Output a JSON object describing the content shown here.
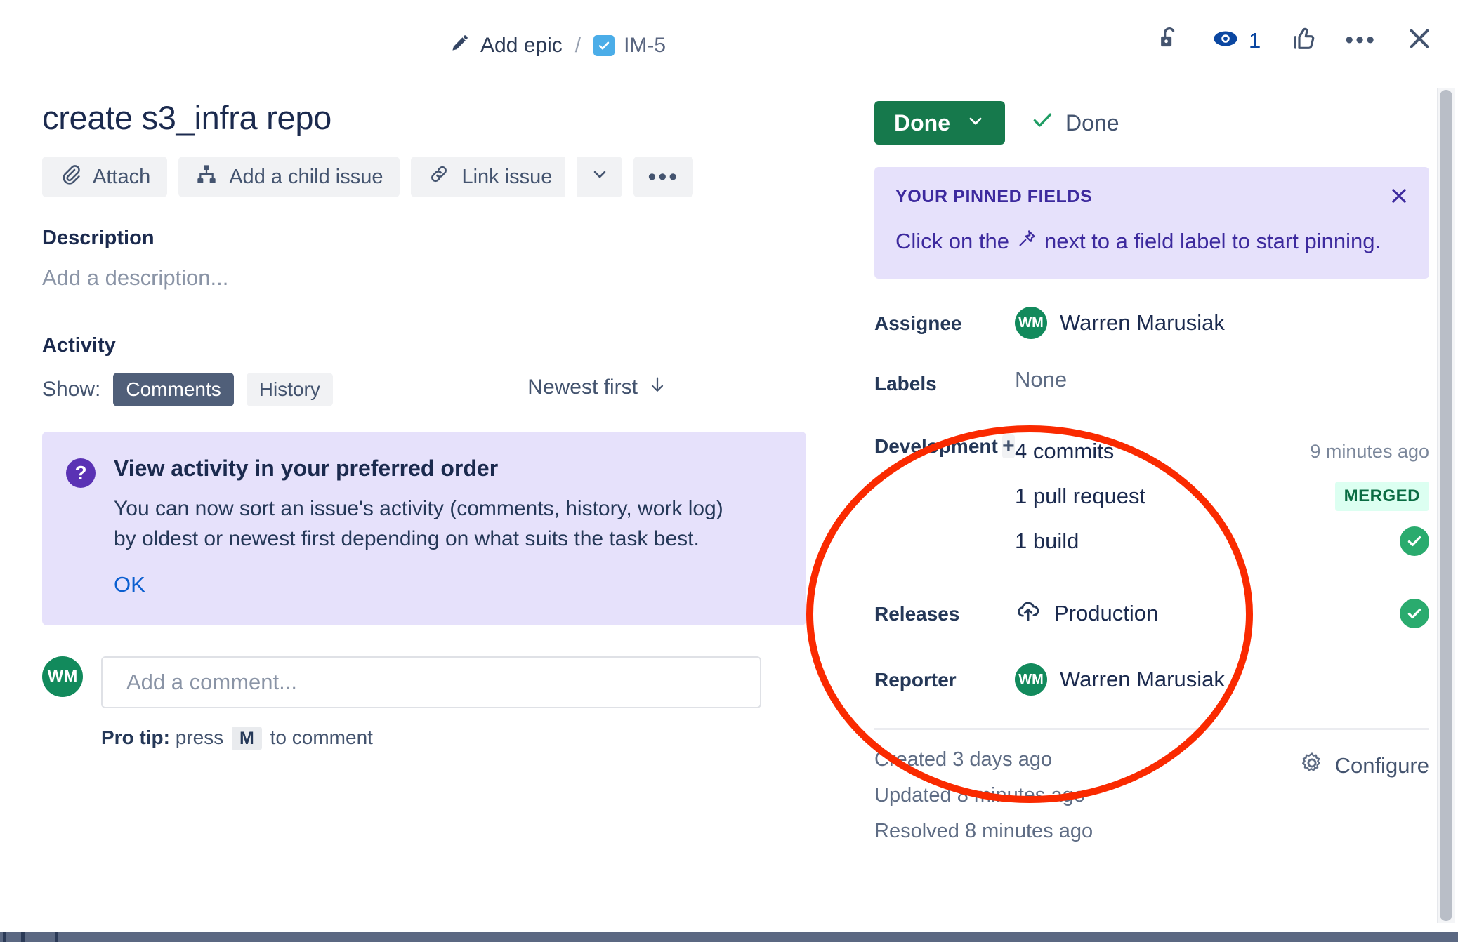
{
  "breadcrumb": {
    "epic_label": "Add epic",
    "separator": "/",
    "issue_key": "IM-5",
    "epic_icon": "pencil-icon",
    "issue_type_icon": "task-checkbox-icon"
  },
  "top_actions": {
    "lock_icon": "unlocked-padlock-icon",
    "watch_icon": "eye-icon",
    "watch_count": "1",
    "vote_icon": "thumbs-up-icon",
    "more_icon": "more-options-icon",
    "more_label": "•••",
    "close_icon": "close-x-icon"
  },
  "issue": {
    "title": "create s3_infra repo",
    "actions": [
      {
        "label": "Attach",
        "icon": "paperclip-icon"
      },
      {
        "label": "Add a child issue",
        "icon": "child-issue-hierarchy-icon"
      },
      {
        "label": "Link issue",
        "icon": "link-chain-icon"
      }
    ],
    "link_caret_icon": "chevron-down-icon",
    "more_actions_label": "•••"
  },
  "description": {
    "heading": "Description",
    "placeholder": "Add a description..."
  },
  "activity": {
    "heading": "Activity",
    "show_label": "Show:",
    "tabs": [
      {
        "label": "Comments",
        "active": true
      },
      {
        "label": "History",
        "active": false
      }
    ],
    "sort_label": "Newest first",
    "sort_icon": "arrow-down-icon"
  },
  "notice": {
    "icon": "question-mark-icon",
    "title": "View activity in your preferred order",
    "body": "You can now sort an issue's activity (comments, history, work log) by oldest or newest first depending on what suits the task best.",
    "ok_label": "OK"
  },
  "comment": {
    "avatar_initials": "WM",
    "placeholder": "Add a comment...",
    "protip_prefix": "Pro tip:",
    "protip_mid": "press",
    "protip_key": "M",
    "protip_suffix": "to comment"
  },
  "status": {
    "button_label": "Done",
    "caret_icon": "chevron-down-icon",
    "resolution_label": "Done",
    "check_icon": "check-icon",
    "accent_color": "#16794c"
  },
  "pinned_fields": {
    "title": "YOUR PINNED FIELDS",
    "body_prefix": "Click on the",
    "pin_icon": "pin-icon",
    "body_suffix": "next to a field label to start pinning.",
    "close_icon": "close-x-icon",
    "background_color": "#e6e1fb",
    "text_color": "#3d2a9e"
  },
  "details": {
    "assignee": {
      "label": "Assignee",
      "avatar_initials": "WM",
      "name": "Warren Marusiak"
    },
    "labels": {
      "label": "Labels",
      "value": "None"
    },
    "development": {
      "label": "Development",
      "add_icon": "plus-icon",
      "items": [
        {
          "name": "4 commits",
          "count": "4",
          "noun": "commits",
          "meta": "9 minutes ago",
          "status_type": "time"
        },
        {
          "name": "1 pull request",
          "count": "1",
          "noun": "pull request",
          "meta": "MERGED",
          "status_type": "badge"
        },
        {
          "name": "1 build",
          "count": "1",
          "noun": "build",
          "meta": "",
          "status_type": "check"
        }
      ]
    },
    "releases": {
      "label": "Releases",
      "icon": "cloud-upload-icon",
      "value": "Production",
      "status_type": "check"
    },
    "reporter": {
      "label": "Reporter",
      "avatar_initials": "WM",
      "name": "Warren Marusiak"
    }
  },
  "footer": {
    "created": "Created 3 days ago",
    "updated": "Updated 8 minutes ago",
    "resolved": "Resolved 8 minutes ago",
    "configure_label": "Configure",
    "configure_icon": "gear-icon"
  },
  "annotation": {
    "shape": "ellipse",
    "color": "#fa2a00",
    "highlights": "development-releases-reporter-fields"
  },
  "avatar_color": "#128a5c"
}
